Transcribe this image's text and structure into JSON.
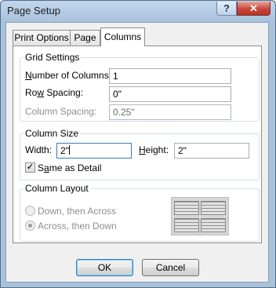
{
  "window": {
    "title": "Page Setup",
    "help_glyph": "?",
    "close_glyph": "✕"
  },
  "tabs": [
    {
      "label": "Print Options",
      "active": false
    },
    {
      "label": "Page",
      "active": false
    },
    {
      "label": "Columns",
      "active": true
    }
  ],
  "grid_settings": {
    "title": "Grid Settings",
    "num_columns_label": "Number of Columns:",
    "num_columns_value": "1",
    "row_spacing_label": "Row Spacing:",
    "row_spacing_value": "0\"",
    "column_spacing_label": "Column Spacing:",
    "column_spacing_value": "0.25\""
  },
  "column_size": {
    "title": "Column Size",
    "width_label": "Width:",
    "width_value": "2\"",
    "height_label": "Height:",
    "height_value": "2\"",
    "same_as_detail_label": "Same as Detail",
    "same_as_detail_checked": true
  },
  "column_layout": {
    "title": "Column Layout",
    "option_down_across": "Down, then Across",
    "option_across_down": "Across, then Down",
    "selected": "Across, then Down"
  },
  "buttons": {
    "ok": "OK",
    "cancel": "Cancel"
  }
}
